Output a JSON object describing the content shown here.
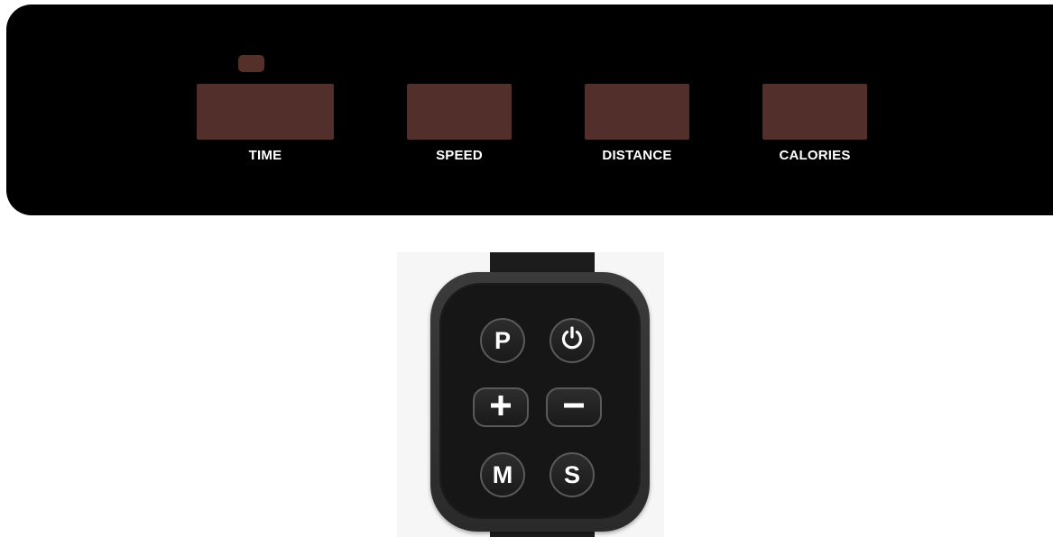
{
  "console": {
    "displays": [
      {
        "label": "TIME"
      },
      {
        "label": "SPEED"
      },
      {
        "label": "DISTANCE"
      },
      {
        "label": "CALORIES"
      }
    ]
  },
  "remote": {
    "buttons": {
      "program": "P",
      "power_icon": "power-icon",
      "plus_icon": "plus-icon",
      "minus_icon": "minus-icon",
      "mode": "M",
      "speed": "S"
    }
  },
  "colors": {
    "console_bg": "#000000",
    "display_off": "#532f2b",
    "label": "#ffffff",
    "remote_body": "#2a2a2a"
  }
}
